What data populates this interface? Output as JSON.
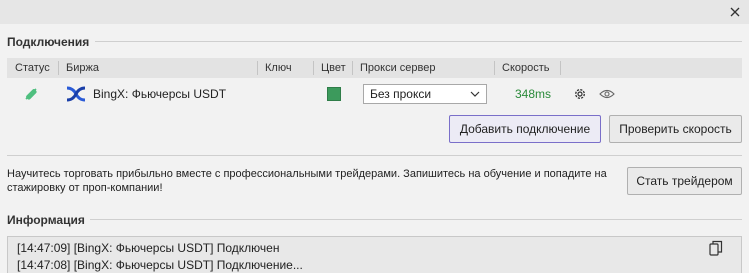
{
  "window": {
    "close_icon": "close-icon"
  },
  "connections": {
    "title": "Подключения",
    "columns": {
      "status": "Статус",
      "exchange": "Биржа",
      "key": "Ключ",
      "color": "Цвет",
      "proxy": "Прокси сервер",
      "speed": "Скорость"
    },
    "rows": [
      {
        "status_icon": "connected-plug-icon",
        "exchange_icon": "bingx-logo-icon",
        "exchange_name": "BingX: Фьючерсы USDT",
        "key": "",
        "color": "#3c9a5c",
        "proxy": "Без прокси",
        "speed": "348ms",
        "settings_icon": "gear-icon",
        "visibility_icon": "eye-icon"
      }
    ],
    "add_button": "Добавить подключение",
    "check_speed_button": "Проверить скорость"
  },
  "promo": {
    "text": "Научитесь торговать прибыльно вместе с профессиональными трейдерами. Запишитесь на обучение и попадите на стажировку от проп-компании!",
    "button": "Стать трейдером"
  },
  "info": {
    "title": "Информация",
    "log": [
      "[14:47:09] [BingX: Фьючерсы USDT] Подключен",
      "[14:47:08] [BingX: Фьючерсы USDT] Подключение..."
    ],
    "copy_icon": "copy-icon"
  }
}
